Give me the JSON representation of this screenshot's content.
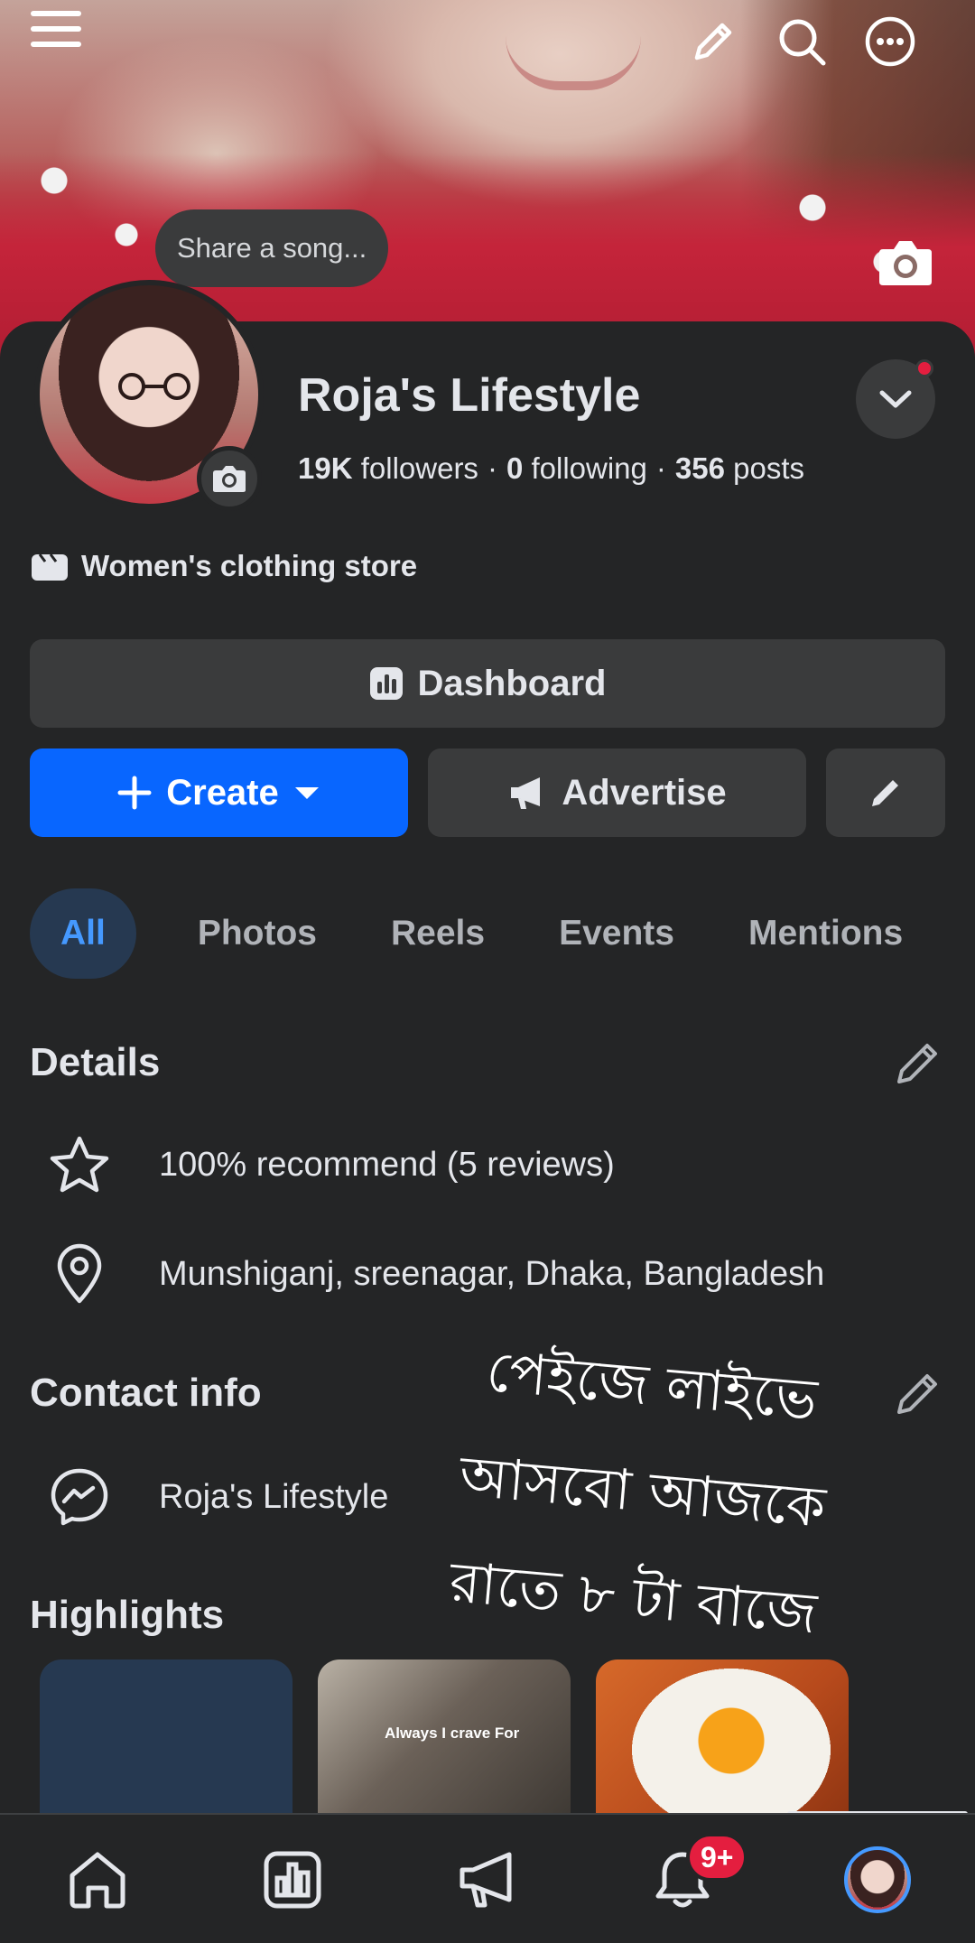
{
  "cover": {
    "song_prompt": "Share a song..."
  },
  "profile": {
    "name": "Roja's Lifestyle",
    "followers_count": "19K",
    "followers_label": "followers",
    "following_count": "0",
    "following_label": "following",
    "posts_count": "356",
    "posts_label": "posts",
    "category": "Women's clothing store"
  },
  "actions": {
    "dashboard_label": "Dashboard",
    "create_label": "Create",
    "advertise_label": "Advertise"
  },
  "tabs": [
    {
      "label": "All",
      "active": true
    },
    {
      "label": "Photos",
      "active": false
    },
    {
      "label": "Reels",
      "active": false
    },
    {
      "label": "Events",
      "active": false
    },
    {
      "label": "Mentions",
      "active": false
    }
  ],
  "details": {
    "title": "Details",
    "rating": "100% recommend (5 reviews)",
    "location": "Munshiganj, sreenagar, Dhaka, Bangladesh"
  },
  "contact": {
    "title": "Contact info",
    "messenger": "Roja's Lifestyle"
  },
  "overlay": {
    "line1": "পেইজে লাইভে",
    "line2": "আসবো আজকে",
    "line3": "রাতে ৮ টা বাজে"
  },
  "highlights": {
    "title": "Highlights",
    "items": [
      {
        "caption": ""
      },
      {
        "caption": "Always I crave For"
      },
      {
        "caption": ""
      }
    ]
  },
  "bottom_nav": {
    "notifications_badge": "9+"
  },
  "colors": {
    "accent": "#0866ff",
    "active_tab_bg": "#263951",
    "active_tab_text": "#4599ff",
    "badge": "#e41e3f",
    "background": "#242526",
    "button_bg": "#3a3b3c"
  }
}
